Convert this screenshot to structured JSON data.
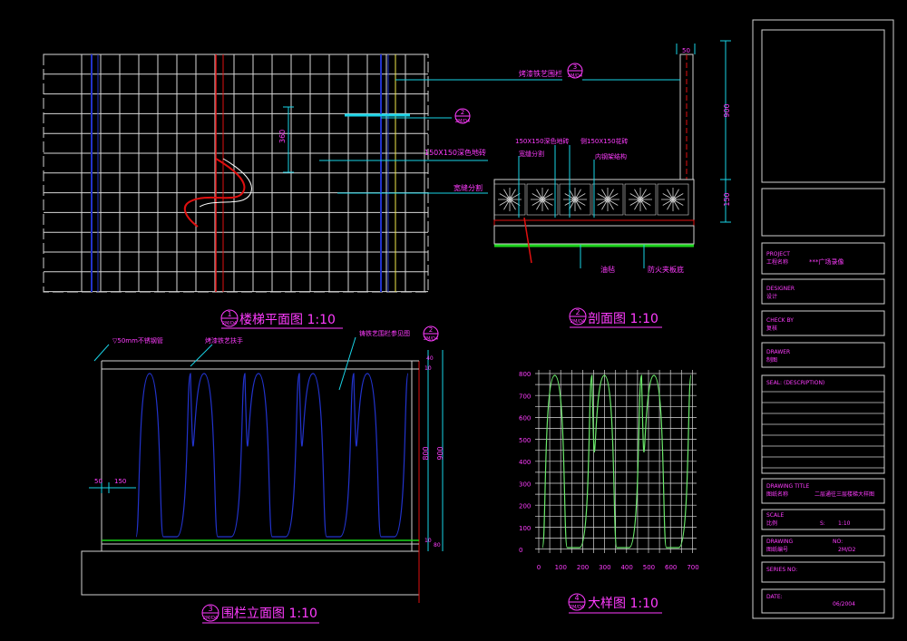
{
  "colors": {
    "background": "#000000",
    "frame": "#d0d0d0",
    "grid": "#d8d8d8",
    "cyan": "#19d3e6",
    "magenta": "#ff3cff",
    "yellow": "#f2ea4a",
    "green": "#19d219",
    "blue": "#2233cc",
    "red": "#e01010",
    "lightgreen": "#6be86b",
    "white": "#ffffff"
  },
  "plan": {
    "title": "楼梯平面图 1:10",
    "ref_num": "1",
    "ref_sheet": "2M/D4",
    "dim_360": "360",
    "callout": {
      "num": "2",
      "sheet": "2M/D4"
    },
    "notes": [
      "150X150深色地砖",
      "宽缝分割"
    ]
  },
  "section": {
    "title": "剖面图 1:10",
    "ref_num": "2",
    "ref_sheet": "2M/D4",
    "callout_top": {
      "num": "3",
      "sheet": "2M/D4",
      "label": "烤漆铁艺围栏"
    },
    "labels": {
      "tile_dark": "150X150深色地砖",
      "wide_gap": "宽缝分割",
      "tile_flower": "侧150X150花砖",
      "steel": "内钢架结构",
      "floor": "油毡",
      "board": "防火夹板底"
    },
    "dims": {
      "top": "50",
      "height": "900",
      "bottom": "150"
    }
  },
  "elevation": {
    "title": "围栏立面图 1:10",
    "ref_num": "3",
    "ref_sheet": "2M/D4",
    "labels": {
      "pipe": "▽50mm不锈钢管",
      "handrail": "烤漆铁艺扶手",
      "detail_ref": "铸铁艺围栏参见图"
    },
    "callout": {
      "num": "2",
      "sheet": "2M/D4"
    },
    "dims": {
      "d50": "50",
      "d150": "150",
      "d900": "900",
      "d800": "800",
      "d40": "40",
      "d80": "80",
      "d10": "10"
    }
  },
  "detail": {
    "title": "大样图 1:10",
    "ref_num": "4",
    "ref_sheet": "2M/D4",
    "y_ticks": [
      "800",
      "700",
      "600",
      "500",
      "400",
      "300",
      "200",
      "100",
      "0"
    ],
    "x_ticks": [
      "0",
      "100",
      "200",
      "300",
      "400",
      "500",
      "600",
      "700"
    ]
  },
  "titleblock": {
    "project_label_en": "PROJECT",
    "project_label_cn": "工程名称",
    "project_value": "***广场录像",
    "designer_en": "DESIGNER",
    "designer_cn": "设计",
    "check_en": "CHECK BY",
    "check_cn": "复核",
    "drawer_en": "DRAWER",
    "drawer_cn": "制图",
    "seal": "SEAL: (DESCRIPTION)",
    "drawing_title_en": "DRAWING TITLE",
    "drawing_title_cn": "图纸名称",
    "drawing_title_value": "二层通往三层楼梯大样图",
    "scale_en": "SCALE",
    "scale_cn": "比例",
    "scale_s": "S:",
    "scale_value": "1:10",
    "drawing_no_en": "DRAWING",
    "drawing_no_label": "NO:",
    "drawing_no_cn": "图纸编号",
    "drawing_no_value": "2M/D2",
    "series": "SERIES NO:",
    "date_label": "DATE:",
    "date_value": "06/2004"
  }
}
